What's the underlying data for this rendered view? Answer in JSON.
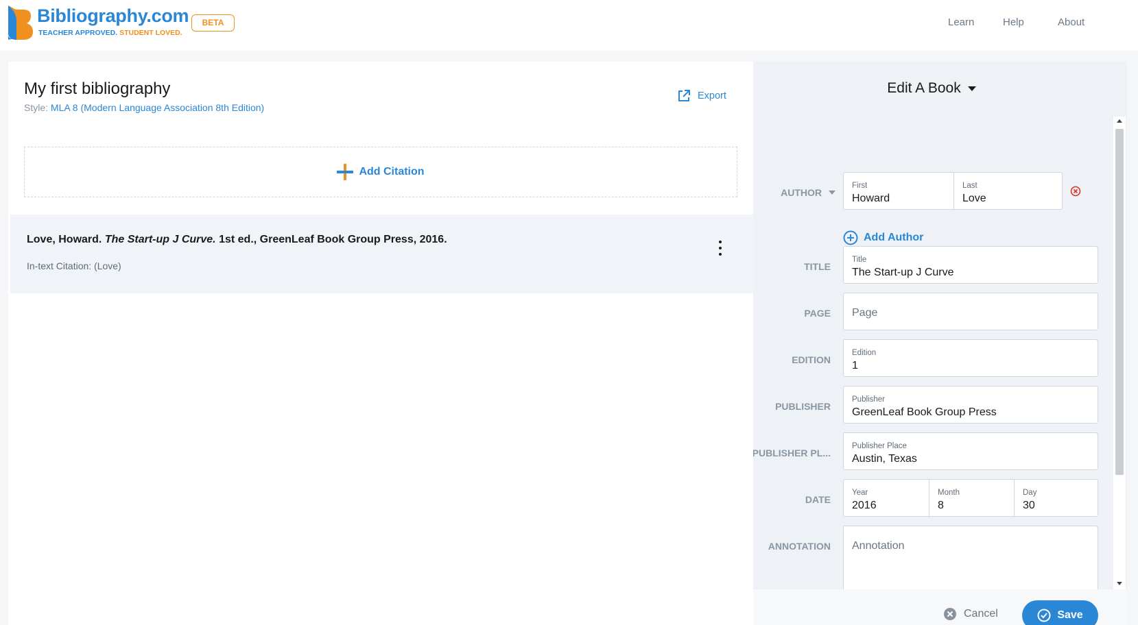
{
  "header": {
    "logo_title": "Bibliography.com",
    "tagline_part1": "TEACHER APPROVED.",
    "tagline_part2": "STUDENT LOVED.",
    "beta_badge": "BETA",
    "nav": [
      "Learn",
      "Help",
      "About"
    ]
  },
  "bibliography": {
    "title": "My first bibliography",
    "style_label": "Style:",
    "style_value": "MLA 8 (Modern Language Association 8th Edition)",
    "export_label": "Export",
    "add_citation_label": "Add Citation",
    "citation": {
      "prefix": "Love, Howard.",
      "book_title": "The Start-up J Curve.",
      "suffix": "1st ed., GreenLeaf Book Group Press, 2016.",
      "intext": "In-text Citation: (Love)"
    }
  },
  "editor": {
    "heading": "Edit A Book",
    "fields": {
      "author": {
        "label": "AUTHOR",
        "first_label": "First",
        "first_value": "Howard",
        "last_label": "Last",
        "last_value": "Love"
      },
      "add_author_label": "Add Author",
      "title": {
        "label": "TITLE",
        "mini": "Title",
        "value": "The Start-up J Curve"
      },
      "page": {
        "label": "PAGE",
        "placeholder": "Page"
      },
      "edition": {
        "label": "EDITION",
        "mini": "Edition",
        "value": "1"
      },
      "publisher": {
        "label": "PUBLISHER",
        "mini": "Publisher",
        "value": "GreenLeaf Book Group Press"
      },
      "publisher_place": {
        "label": "PUBLISHER PL...",
        "mini": "Publisher Place",
        "value": "Austin, Texas"
      },
      "date": {
        "label": "DATE",
        "year_label": "Year",
        "year_value": "2016",
        "month_label": "Month",
        "month_value": "8",
        "day_label": "Day",
        "day_value": "30"
      },
      "annotation": {
        "label": "ANNOTATION",
        "placeholder": "Annotation"
      }
    },
    "cancel_label": "Cancel",
    "save_label": "Save"
  },
  "colors": {
    "brand_blue": "#2a87d6",
    "brand_orange": "#f0901e",
    "danger_red": "#e0302a"
  }
}
